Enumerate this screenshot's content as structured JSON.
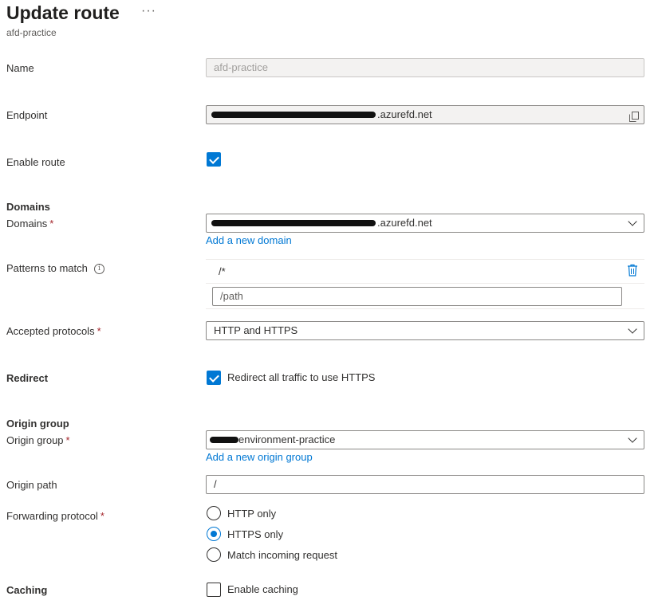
{
  "header": {
    "title": "Update route",
    "subtitle": "afd-practice",
    "more_label": "···"
  },
  "form": {
    "name": {
      "label": "Name",
      "value": "afd-practice"
    },
    "endpoint": {
      "label": "Endpoint",
      "value_suffix": ".azurefd.net"
    },
    "enable_route": {
      "label": "Enable route",
      "checked": true
    },
    "domains_section": "Domains",
    "domains": {
      "label": "Domains",
      "required_mark": "*",
      "value_suffix": ".azurefd.net",
      "add_link": "Add a new domain"
    },
    "patterns": {
      "label": "Patterns to match",
      "info_icon": "i",
      "items": [
        "/*"
      ],
      "input_placeholder": "/path"
    },
    "accepted_protocols": {
      "label": "Accepted protocols",
      "required_mark": "*",
      "value": "HTTP and HTTPS"
    },
    "redirect_section": "Redirect",
    "redirect": {
      "checkbox_label": "Redirect all traffic to use HTTPS",
      "checked": true
    },
    "origin_group_section": "Origin group",
    "origin_group": {
      "label": "Origin group",
      "required_mark": "*",
      "value_suffix": "environment-practice",
      "add_link": "Add a new origin group"
    },
    "origin_path": {
      "label": "Origin path",
      "value": "/"
    },
    "forwarding_protocol": {
      "label": "Forwarding protocol",
      "required_mark": "*",
      "options": [
        "HTTP only",
        "HTTPS only",
        "Match incoming request"
      ],
      "selected": "HTTPS only"
    },
    "caching_section": "Caching",
    "caching": {
      "checkbox_label": "Enable caching",
      "checked": false
    }
  },
  "colors": {
    "accent": "#0078d4",
    "required": "#a4262c",
    "text": "#323130"
  }
}
